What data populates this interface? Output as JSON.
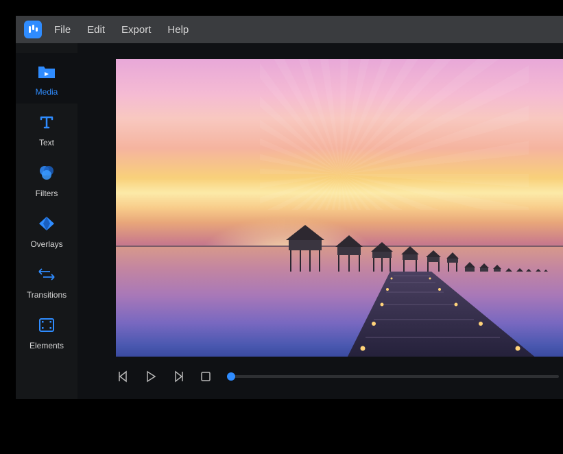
{
  "menu": {
    "items": [
      "File",
      "Edit",
      "Export",
      "Help"
    ]
  },
  "sidebar": {
    "items": [
      {
        "label": "Media",
        "icon": "folder-play-icon",
        "active": true
      },
      {
        "label": "Text",
        "icon": "text-icon",
        "active": false
      },
      {
        "label": "Filters",
        "icon": "venn-icon",
        "active": false
      },
      {
        "label": "Overlays",
        "icon": "diamond-icon",
        "active": false
      },
      {
        "label": "Transitions",
        "icon": "arrows-icon",
        "active": false
      },
      {
        "label": "Elements",
        "icon": "film-icon",
        "active": false
      }
    ]
  },
  "playback": {
    "controls": [
      "frame-back",
      "play",
      "frame-forward",
      "stop"
    ],
    "position": 0
  },
  "colors": {
    "accent": "#2f8cff"
  }
}
